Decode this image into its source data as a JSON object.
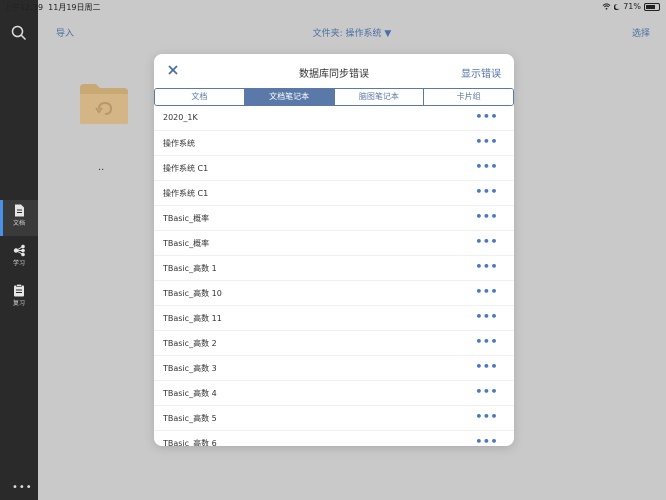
{
  "status_bar": {
    "time": "上午12:39",
    "date": "11月19日周二",
    "battery": "71%",
    "battery_level": 0.71
  },
  "sidebar": {
    "items": [
      {
        "label": "文档",
        "icon": "document-icon",
        "active": true
      },
      {
        "label": "学习",
        "icon": "share-nodes-icon",
        "active": false
      },
      {
        "label": "复习",
        "icon": "clipboard-icon",
        "active": false
      }
    ],
    "more": "•••"
  },
  "topbar": {
    "import_label": "导入",
    "folder_title": "文件夹: 操作系统 ▼",
    "select_label": "选择"
  },
  "folder": {
    "name": ".."
  },
  "modal": {
    "title": "数据库同步错误",
    "show_errors_label": "显示错误",
    "tabs": [
      "文档",
      "文档笔记本",
      "脑图笔记本",
      "卡片组"
    ],
    "active_tab": 1,
    "rows": [
      "2020_1K",
      "操作系统",
      "操作系统 C1",
      "操作系统 C1",
      "TBasic_概率",
      "TBasic_概率",
      "TBasic_高数 1",
      "TBasic_高数 10",
      "TBasic_高数 11",
      "TBasic_高数 2",
      "TBasic_高数 3",
      "TBasic_高数 4",
      "TBasic_高数 5",
      "TBasic_高数 6"
    ],
    "row_more_label": "•••"
  },
  "colors": {
    "accent": "#5a79a8",
    "link": "#4a6fa5",
    "sidebar_bg": "#2a2a2a",
    "active_indicator": "#4a8fe8"
  }
}
